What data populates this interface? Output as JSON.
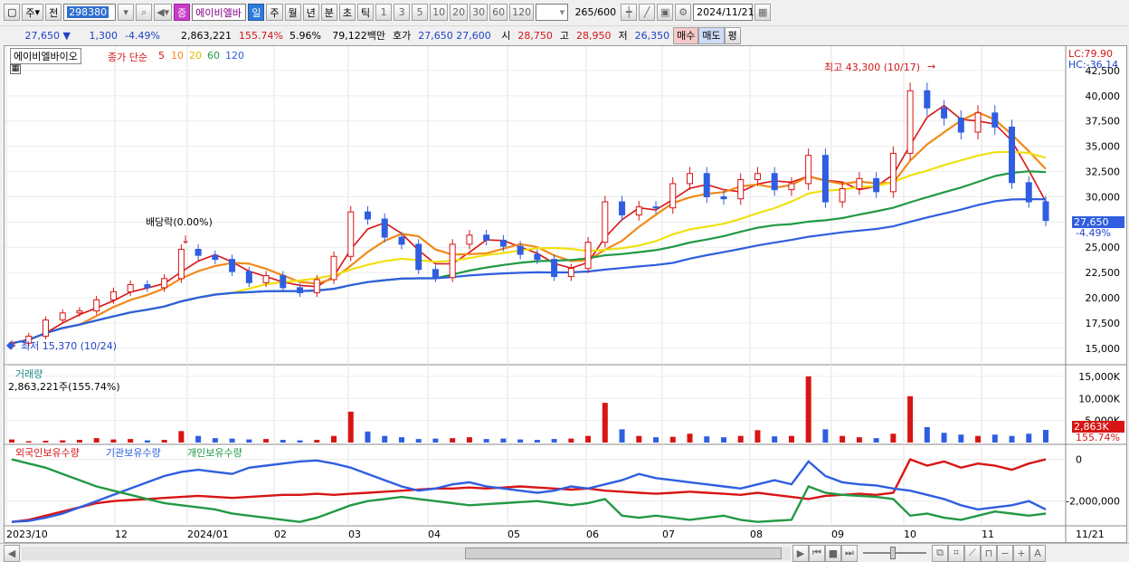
{
  "toolbar": {
    "market": "주",
    "prev": "전",
    "code": "298380",
    "name": "에이비엘바",
    "periods": [
      "일",
      "주",
      "월",
      "년",
      "분",
      "초",
      "틱"
    ],
    "active_period": "일",
    "numbers": [
      "1",
      "3",
      "5",
      "10",
      "20",
      "30",
      "60",
      "120"
    ],
    "count": "265",
    "total": "/600",
    "date": "2024/11/21"
  },
  "quote": {
    "price": "27,650",
    "change": "1,300",
    "rate": "-4.49%",
    "volume": "2,863,221",
    "vol_rate": "155.74%",
    "turnover_rate": "5.96%",
    "amount": "79,122백만",
    "ask_label": "호가",
    "ask": "27,650",
    "bid": "27,600",
    "open_label": "시",
    "open": "28,750",
    "high_label": "고",
    "high": "28,950",
    "low_label": "저",
    "low": "26,350",
    "buy": "매수",
    "sell": "매도",
    "avg": "평"
  },
  "price_panel": {
    "stock_name": "에이비엘바이오",
    "legend_prefix": "종가 단순",
    "ma": [
      "5",
      "10",
      "20",
      "60",
      "120"
    ],
    "ma_colors": [
      "#d81414",
      "#f08a1a",
      "#f0e010",
      "#229944",
      "#2f5ee0"
    ],
    "lc": "LC:79.90",
    "hc": "HC:-36.14",
    "max_label": "최고 43,300 (10/17)",
    "min_label": "최저 15,370 (10/24)",
    "dividend_label": "배당락(0.00%)",
    "current_price": "27,650",
    "current_rate": "-4.49%",
    "y_ticks": [
      "42,500",
      "40,000",
      "37,500",
      "35,000",
      "32,500",
      "30,000",
      "27,500",
      "25,000",
      "22,500",
      "20,000",
      "17,500",
      "15,000"
    ]
  },
  "volume_panel": {
    "title": "거래량",
    "value": "2,863,221주(155.74%)",
    "y_ticks": [
      "15,000K",
      "10,000K",
      "5,000K"
    ],
    "current": "2,863K",
    "current_rate": "155.74%"
  },
  "holding_panel": {
    "series": [
      "외국인보유수량",
      "기관보유수량",
      "개인보유수량"
    ],
    "colors": [
      "#d81414",
      "#2f5ee0",
      "#229944"
    ],
    "y_ticks": [
      "0",
      "-2,000,000"
    ]
  },
  "x_axis": [
    "2023/10",
    "12",
    "2024/01",
    "02",
    "03",
    "04",
    "05",
    "06",
    "07",
    "08",
    "09",
    "10",
    "11",
    "11/21"
  ],
  "chart_data": {
    "type": "candlestick",
    "title": "에이비엘바이오",
    "ylim": [
      14000,
      43300
    ],
    "close": [
      15500,
      16200,
      17800,
      18500,
      18700,
      19800,
      20600,
      21300,
      21000,
      21900,
      24800,
      24200,
      23800,
      22600,
      21500,
      22200,
      21000,
      20500,
      21800,
      24100,
      28500,
      27800,
      26000,
      25300,
      22800,
      22000,
      25300,
      26200,
      25700,
      25100,
      24300,
      23800,
      22100,
      22900,
      25500,
      29500,
      28200,
      29000,
      28900,
      31300,
      32300,
      30000,
      29800,
      31700,
      32300,
      30700,
      31300,
      34100,
      29500,
      30800,
      31800,
      30500,
      34300,
      40500,
      38800,
      37800,
      36400,
      38300,
      36900,
      31400,
      29500,
      27650
    ],
    "vol_k": [
      700,
      300,
      400,
      500,
      600,
      1000,
      700,
      800,
      500,
      600,
      2600,
      1500,
      1000,
      900,
      700,
      800,
      600,
      500,
      600,
      1500,
      7000,
      2500,
      1500,
      1200,
      800,
      900,
      1000,
      1200,
      800,
      900,
      700,
      600,
      800,
      900,
      1500,
      9000,
      3000,
      1500,
      1200,
      1300,
      2000,
      1400,
      1200,
      1500,
      2800,
      1400,
      1500,
      15000,
      3000,
      1500,
      1200,
      1000,
      2000,
      10500,
      3500,
      2200,
      1800,
      1500,
      1800,
      1500,
      2000,
      2863
    ],
    "foreign": [
      -3000000,
      -2900000,
      -2700000,
      -2500000,
      -2300000,
      -2100000,
      -2000000,
      -1950000,
      -1900000,
      -1850000,
      -1800000,
      -1750000,
      -1800000,
      -1850000,
      -1800000,
      -1750000,
      -1700000,
      -1700000,
      -1650000,
      -1700000,
      -1650000,
      -1600000,
      -1550000,
      -1500000,
      -1450000,
      -1400000,
      -1400000,
      -1350000,
      -1400000,
      -1350000,
      -1300000,
      -1350000,
      -1400000,
      -1450000,
      -1400000,
      -1500000,
      -1550000,
      -1600000,
      -1650000,
      -1600000,
      -1550000,
      -1600000,
      -1650000,
      -1700000,
      -1600000,
      -1700000,
      -1800000,
      -1900000,
      -1750000,
      -1700000,
      -1650000,
      -1700000,
      -1600000,
      0,
      -300000,
      -100000,
      -400000,
      -200000,
      -300000,
      -500000,
      -200000,
      0
    ],
    "institution": [
      -3000000,
      -2950000,
      -2800000,
      -2600000,
      -2300000,
      -2000000,
      -1700000,
      -1400000,
      -1100000,
      -800000,
      -600000,
      -500000,
      -600000,
      -700000,
      -400000,
      -300000,
      -200000,
      -100000,
      -50000,
      -200000,
      -400000,
      -700000,
      -1000000,
      -1300000,
      -1500000,
      -1400000,
      -1200000,
      -1100000,
      -1300000,
      -1400000,
      -1500000,
      -1600000,
      -1500000,
      -1300000,
      -1400000,
      -1200000,
      -1000000,
      -700000,
      -900000,
      -1000000,
      -1100000,
      -1200000,
      -1300000,
      -1400000,
      -1200000,
      -1000000,
      -1200000,
      -100000,
      -800000,
      -1100000,
      -1200000,
      -1250000,
      -1400000,
      -1500000,
      -1700000,
      -1900000,
      -2200000,
      -2400000,
      -2300000,
      -2200000,
      -2000000,
      -2400000
    ],
    "individual": [
      0,
      -200000,
      -400000,
      -700000,
      -1000000,
      -1300000,
      -1500000,
      -1700000,
      -1900000,
      -2100000,
      -2200000,
      -2300000,
      -2400000,
      -2600000,
      -2700000,
      -2800000,
      -2900000,
      -3000000,
      -2800000,
      -2500000,
      -2200000,
      -2000000,
      -1900000,
      -1800000,
      -1900000,
      -2000000,
      -2100000,
      -2200000,
      -2150000,
      -2100000,
      -2050000,
      -2000000,
      -2100000,
      -2200000,
      -2100000,
      -1900000,
      -2700000,
      -2800000,
      -2700000,
      -2800000,
      -2900000,
      -2800000,
      -2700000,
      -2900000,
      -3000000,
      -2950000,
      -2900000,
      -1300000,
      -1600000,
      -1700000,
      -1750000,
      -1800000,
      -1900000,
      -2700000,
      -2600000,
      -2800000,
      -2900000,
      -2700000,
      -2500000,
      -2600000,
      -2700000,
      -2600000
    ]
  }
}
